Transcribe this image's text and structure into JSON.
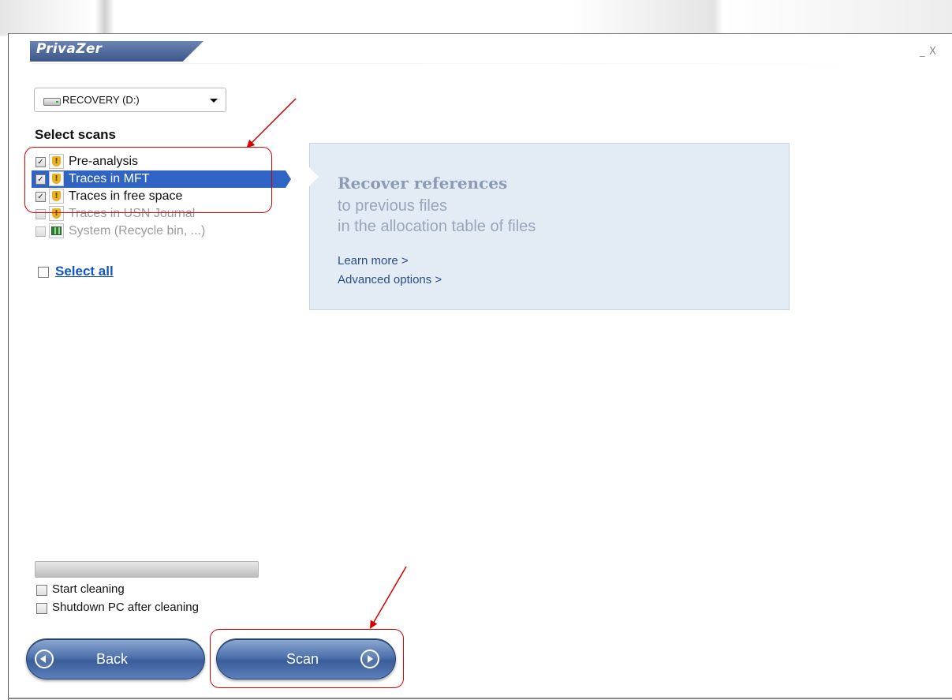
{
  "app": {
    "title": "PrivaZer"
  },
  "window_controls": {
    "minimize": "_",
    "close": "X"
  },
  "drive_select": {
    "value": "RECOVERY (D:)"
  },
  "scans": {
    "title": "Select scans",
    "items": [
      {
        "label": "Pre-analysis",
        "checked": true,
        "state": "normal",
        "icon": "shield-icon"
      },
      {
        "label": "Traces in MFT",
        "checked": true,
        "state": "selected",
        "icon": "shield-icon"
      },
      {
        "label": "Traces in free space",
        "checked": true,
        "state": "normal",
        "icon": "shield-icon"
      },
      {
        "label": "Traces in USN Journal",
        "checked": false,
        "state": "disabled",
        "icon": "shield-icon"
      },
      {
        "label": "System (Recycle bin, ...)",
        "checked": false,
        "state": "disabled",
        "icon": "recycle-bin-icon"
      }
    ],
    "select_all": "Select all"
  },
  "info": {
    "title": "Recover references",
    "line1": "to previous files",
    "line2": "in the allocation table of files",
    "learn_more": "Learn more >",
    "advanced": "Advanced options >"
  },
  "progress": {
    "value": 0
  },
  "options": {
    "start_cleaning": "Start cleaning",
    "shutdown": "Shutdown PC after cleaning"
  },
  "buttons": {
    "back": "Back",
    "scan": "Scan"
  },
  "colors": {
    "selection": "#2f63c4",
    "annotation": "#d40000",
    "link": "#1155cc"
  }
}
